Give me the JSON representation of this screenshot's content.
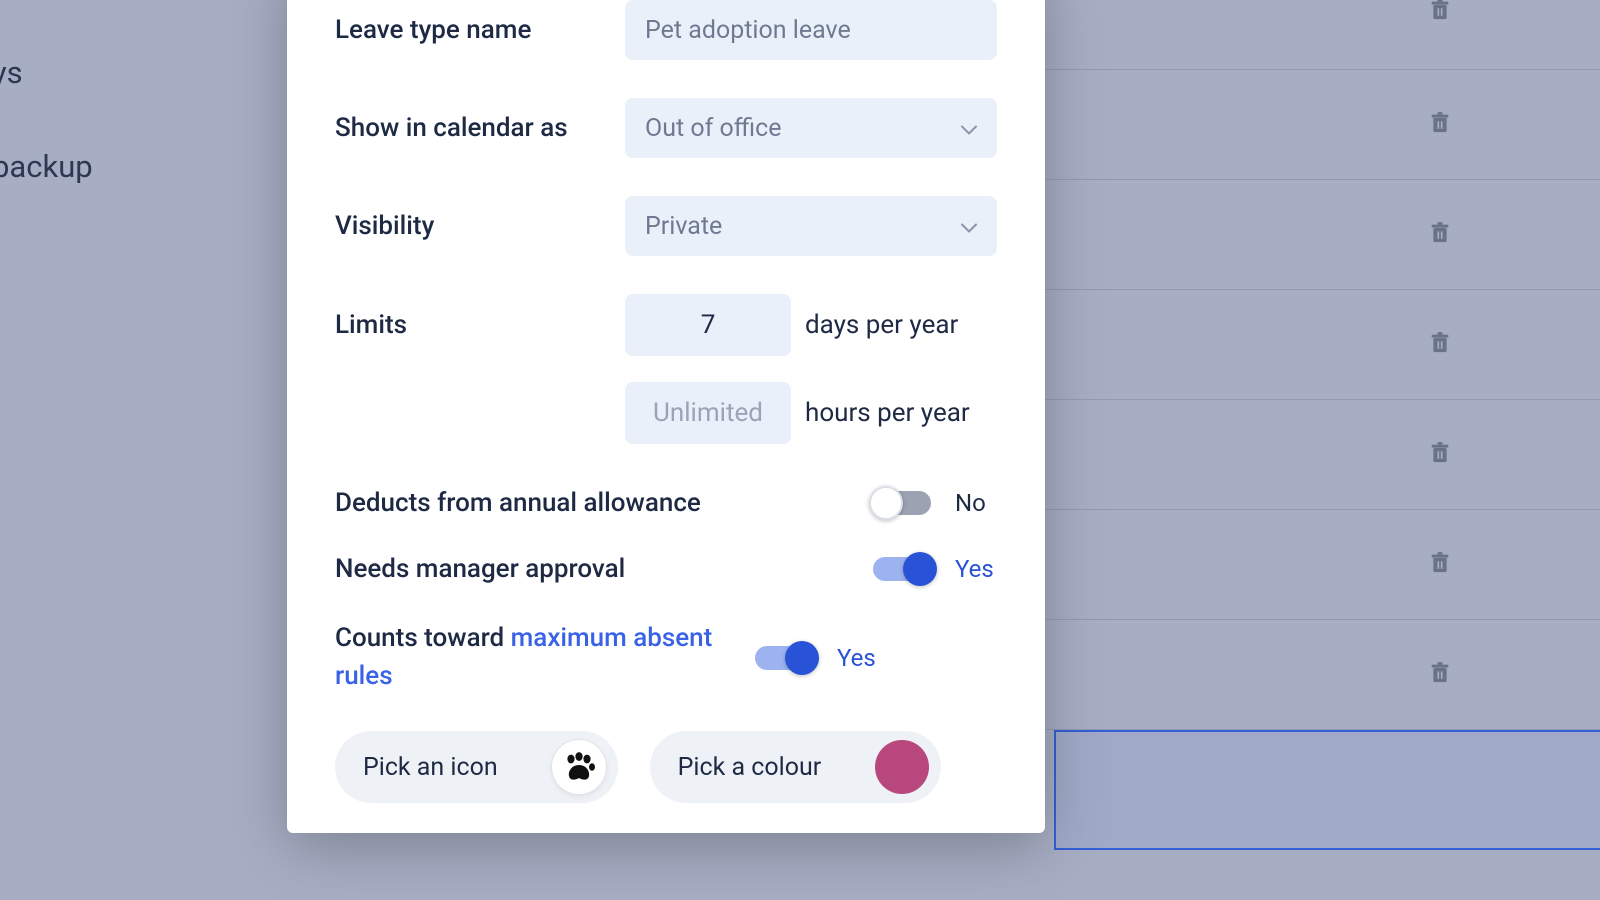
{
  "background": {
    "partial_text_1": "ys",
    "partial_text_2": "backup"
  },
  "modal": {
    "fields": {
      "name": {
        "label": "Leave type name",
        "value": "Pet adoption leave"
      },
      "calendar": {
        "label": "Show in calendar as",
        "value": "Out of office"
      },
      "visibility": {
        "label": "Visibility",
        "value": "Private"
      },
      "limits": {
        "label": "Limits",
        "days_value": "7",
        "days_suffix": "days per year",
        "hours_placeholder": "Unlimited",
        "hours_suffix": "hours per year"
      }
    },
    "toggles": {
      "deducts": {
        "label": "Deducts from annual allowance",
        "state_text": "No"
      },
      "approval": {
        "label": "Needs manager approval",
        "state_text": "Yes"
      },
      "counts": {
        "label_prefix": "Counts toward ",
        "link_text": "maximum absent rules",
        "state_text": "Yes"
      }
    },
    "pickers": {
      "icon_label": "Pick an icon",
      "colour_label": "Pick a colour",
      "colour_value": "#b8477d"
    }
  }
}
